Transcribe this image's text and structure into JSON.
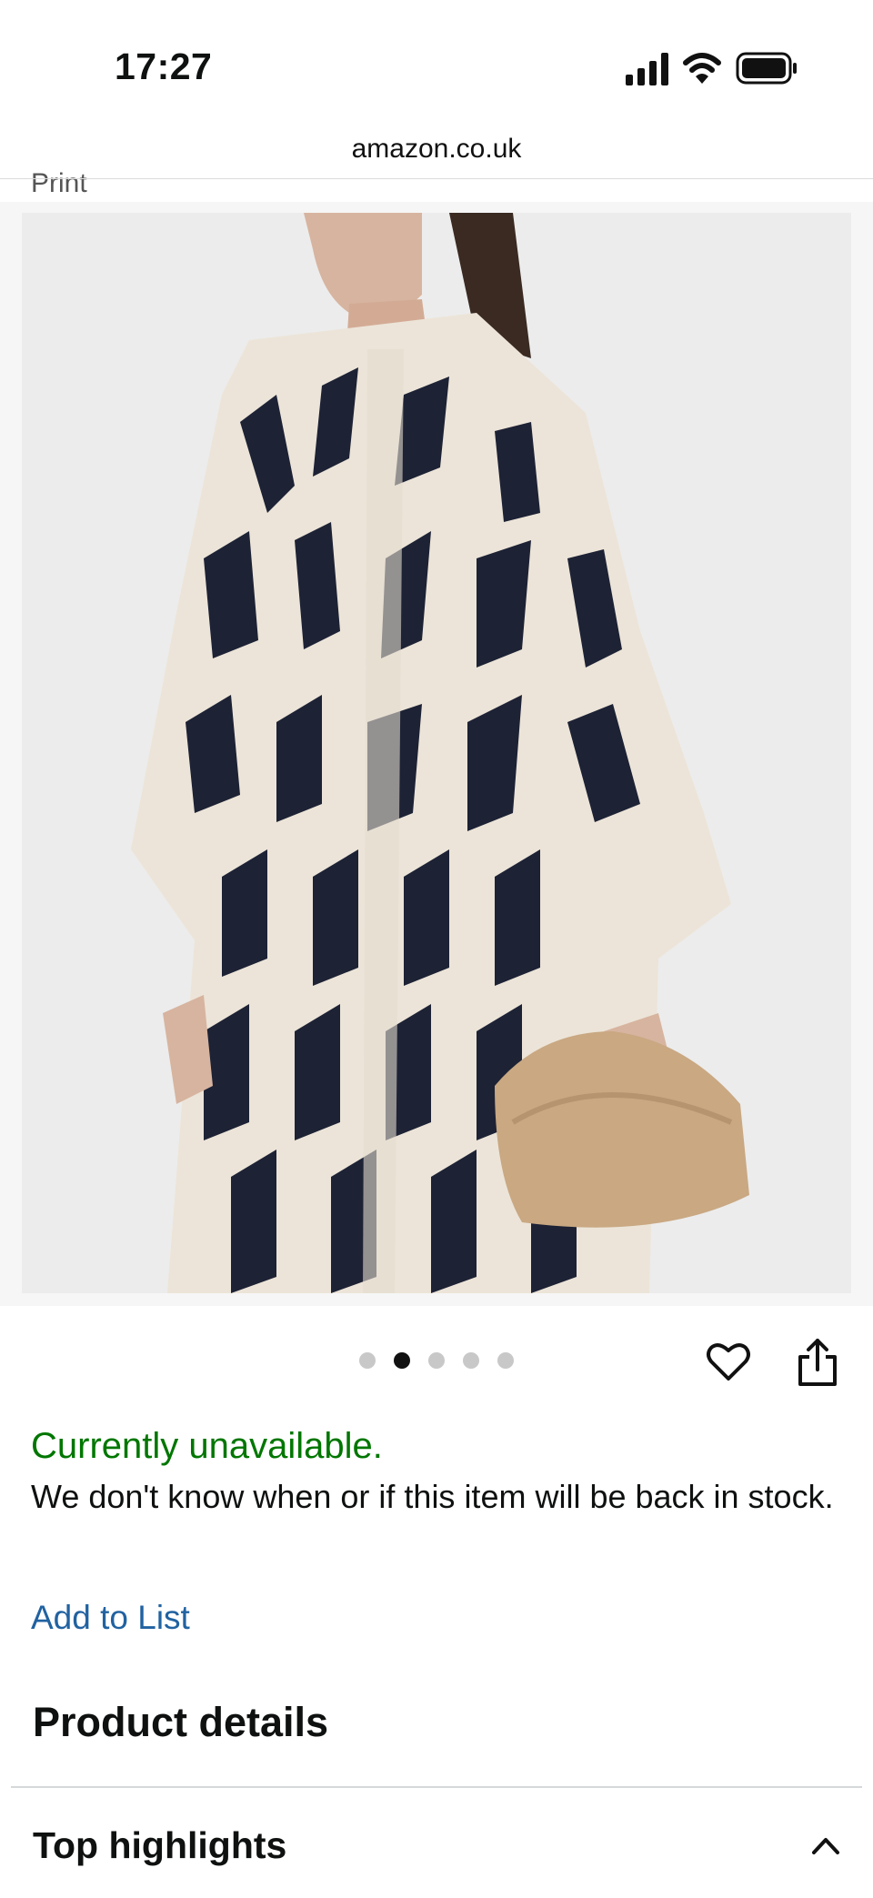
{
  "status_bar": {
    "time": "17:27"
  },
  "browser": {
    "url": "amazon.co.uk"
  },
  "product": {
    "variant_label_partial": "Print",
    "image_alt_icon": "product-photo",
    "carousel": {
      "total": 5,
      "active_index": 1
    }
  },
  "availability": {
    "status": "Currently unavailable.",
    "note": "We don't know when or if this item will be back in stock.",
    "status_color": "#007600"
  },
  "actions": {
    "add_to_list": "Add to List",
    "link_color": "#2162a1"
  },
  "sections": {
    "product_details": "Product details",
    "top_highlights": "Top highlights"
  },
  "icons": {
    "heart": "heart-icon",
    "share": "share-icon",
    "chevron": "chevron-up-icon",
    "signal": "signal-icon",
    "wifi": "wifi-icon",
    "battery": "battery-icon"
  }
}
